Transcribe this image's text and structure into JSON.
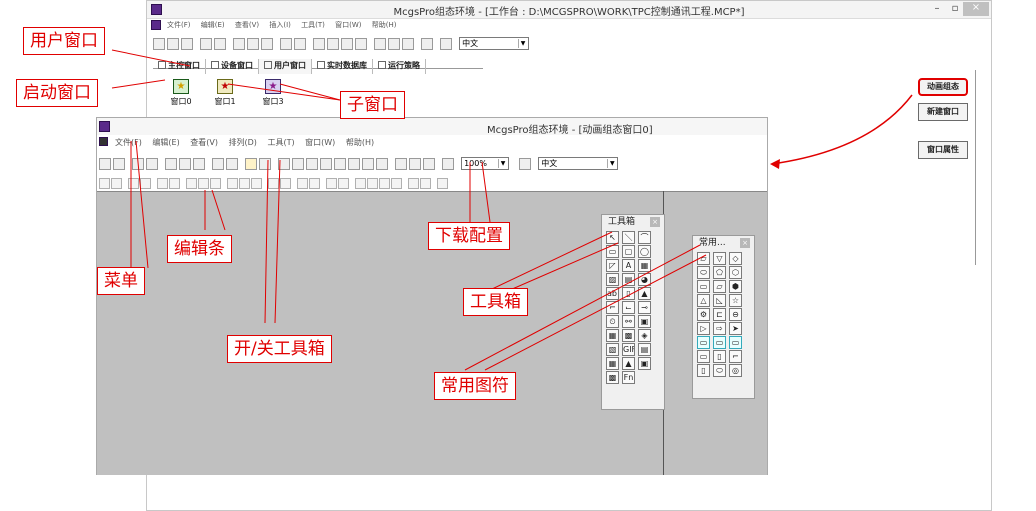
{
  "back_window": {
    "title": "McgsPro组态环境 - [工作台 : D:\\MCGSPRO\\WORK\\TPC控制通讯工程.MCP*]",
    "window_controls": [
      "–",
      "▫",
      "×"
    ],
    "menu": [
      "文件(F)",
      "编辑(E)",
      "查看(V)",
      "插入(I)",
      "工具(T)",
      "窗口(W)",
      "帮助(H)"
    ],
    "language": "中文",
    "tabs": [
      "主控窗口",
      "设备窗口",
      "用户窗口",
      "实时数据库",
      "运行策略"
    ],
    "windows": [
      "窗口0",
      "窗口1",
      "窗口3"
    ],
    "side_buttons": [
      "动画组态",
      "新建窗口",
      "窗口属性"
    ]
  },
  "front_window": {
    "title": "McgsPro组态环境 - [动画组态窗口0]",
    "menu": [
      "文件(F)",
      "编辑(E)",
      "查看(V)",
      "排列(D)",
      "工具(T)",
      "窗口(W)",
      "帮助(H)"
    ],
    "zoom": "100%",
    "language": "中文"
  },
  "toolbox": {
    "title": "工具箱",
    "close": "×",
    "glyphs": [
      "↖",
      "＼",
      "⌒",
      "▭",
      "▢",
      "◯",
      "◸",
      "A",
      "▦",
      "▨",
      "▤",
      "◕",
      "ab|",
      "▯",
      "▲",
      "⌐",
      "⌙",
      "⊸",
      "⏲",
      "⚯",
      "▣",
      "▦",
      "▩",
      "◈",
      "▧",
      "GIF",
      "▤",
      "▦",
      "▲",
      "▣",
      "▩",
      "Fn"
    ]
  },
  "common_symbols": {
    "title": "常用...",
    "close": "×",
    "glyphs": [
      "▱",
      "▽",
      "◇",
      "⬭",
      "⬠",
      "⬡",
      "▭",
      "▱",
      "⬢",
      "△",
      "◺",
      "☆",
      "⚙",
      "⊏",
      "⊖",
      "▷",
      "⇨",
      "➤",
      "▭",
      "▭",
      "▭",
      "▭",
      "▯",
      "⌐",
      "▯",
      "⬭",
      "◎"
    ]
  },
  "annotations": {
    "user_window": "用户窗口",
    "startup_window": "启动窗口",
    "sub_window": "子窗口",
    "edit_bar": "编辑条",
    "menu": "菜单",
    "toggle_toolbox": "开/关工具箱",
    "download_config": "下载配置",
    "toolbox": "工具箱",
    "common_symbols": "常用图符"
  },
  "colors": {
    "annotation_red": "#e00000",
    "canvas_gray": "#c0c0c0",
    "highlight_cyan": "#33aabb"
  }
}
